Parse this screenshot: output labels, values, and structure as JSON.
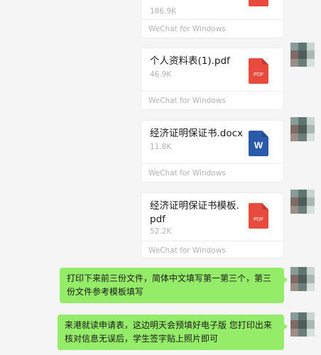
{
  "messages": {
    "file0": {
      "size": "186.9K",
      "source": "WeChat for Windows",
      "icon": "pdf-file-icon"
    },
    "file1": {
      "name": "个人资料表(1).pdf",
      "size": "46.9K",
      "source": "WeChat for Windows",
      "ext": "PDF"
    },
    "file2": {
      "name": "经济证明保证书.docx",
      "size": "11.8K",
      "source": "WeChat for Windows",
      "ext": "W"
    },
    "file3": {
      "name": "经济证明保证书模板.pdf",
      "size": "52.2K",
      "source": "WeChat for Windows",
      "ext": "PDF"
    },
    "text1": "打印下来前三份文件，简体中文填写第一第三个，第三份文件参考模板填写",
    "text2": "来港就读申请表，这边明天会预填好电子版 您打印出来核对信息无误后，学生签字贴上照片即可"
  },
  "colors": {
    "background": "#f5f5f5",
    "bubble_green": "#95ec69",
    "pdf_red": "#e84a3d",
    "word_blue": "#2a5aa8"
  }
}
